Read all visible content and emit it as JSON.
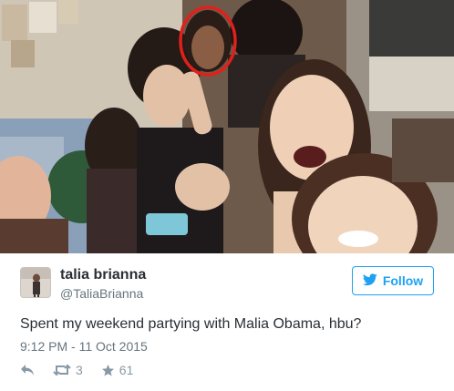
{
  "tweet": {
    "display_name": "talia brianna",
    "handle": "@TaliaBrianna",
    "follow_label": "Follow",
    "text": "Spent my weekend partying with Malia Obama, hbu?",
    "timestamp": "9:12 PM - 11 Oct 2015",
    "retweet_count": "3",
    "like_count": "61"
  },
  "colors": {
    "follow_blue": "#1da1f2",
    "highlight_circle": "#e0201b",
    "action_gray": "#8899a6"
  },
  "icons": [
    "twitter-bird-icon",
    "reply-icon",
    "retweet-icon",
    "star-icon"
  ]
}
